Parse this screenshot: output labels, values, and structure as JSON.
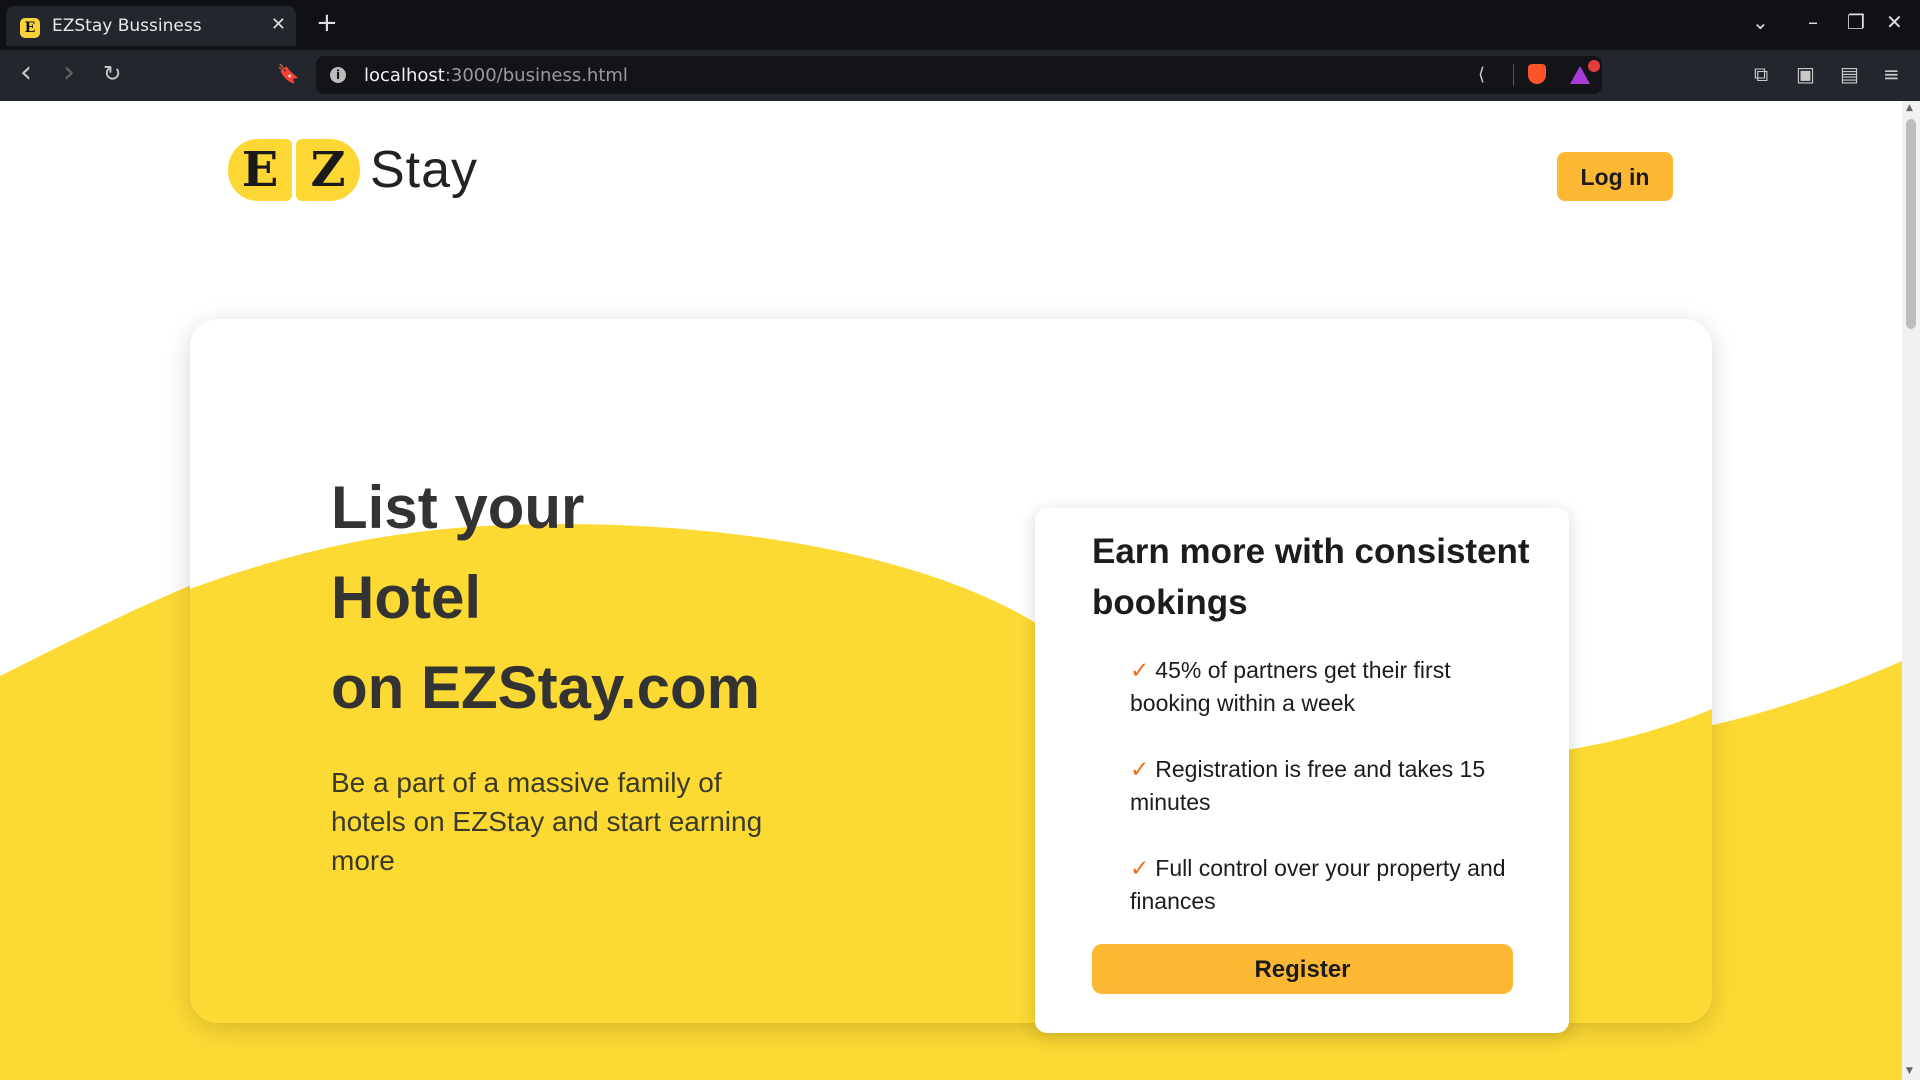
{
  "browser": {
    "tab": {
      "favicon_letter": "E",
      "title": "EZStay Bussiness",
      "close_glyph": "✕"
    },
    "new_tab_glyph": "+",
    "window_controls": {
      "dropdown": "⌄",
      "minimize": "–",
      "restore": "❐",
      "close": "✕"
    },
    "nav": {
      "back": "‹",
      "forward": "›",
      "reload": "↻",
      "bookmark": "🔖"
    },
    "address": {
      "host": "localhost",
      "path": ":3000/business.html",
      "info_glyph": "i"
    },
    "address_icons": {
      "share": "⟨",
      "brave": "brave-shield-icon",
      "rewards": "brave-rewards-icon"
    },
    "toolbar_icons": {
      "extensions": "⧉",
      "sidebar": "▣",
      "wallet": "▤",
      "menu": "≡"
    }
  },
  "colors": {
    "brand_yellow": "#fdd835",
    "button_orange": "#fdb833",
    "check_orange": "#f26a1b",
    "wave_yellow": "#fdda33"
  },
  "header": {
    "logo": {
      "letter1": "E",
      "letter2": "Z",
      "word": "Stay"
    },
    "login_label": "Log in"
  },
  "hero": {
    "title_lines": [
      "List your",
      "Hotel",
      "on EZStay.com"
    ],
    "subtitle": "Be a part of a massive family of hotels on EZStay and start earning more"
  },
  "panel": {
    "title": "Earn more with consistent bookings",
    "check_glyph": "✓",
    "items": [
      "45% of partners get their first booking within a week",
      "Registration is free and takes 15 minutes",
      "Full control over your property and finances"
    ],
    "register_label": "Register"
  }
}
